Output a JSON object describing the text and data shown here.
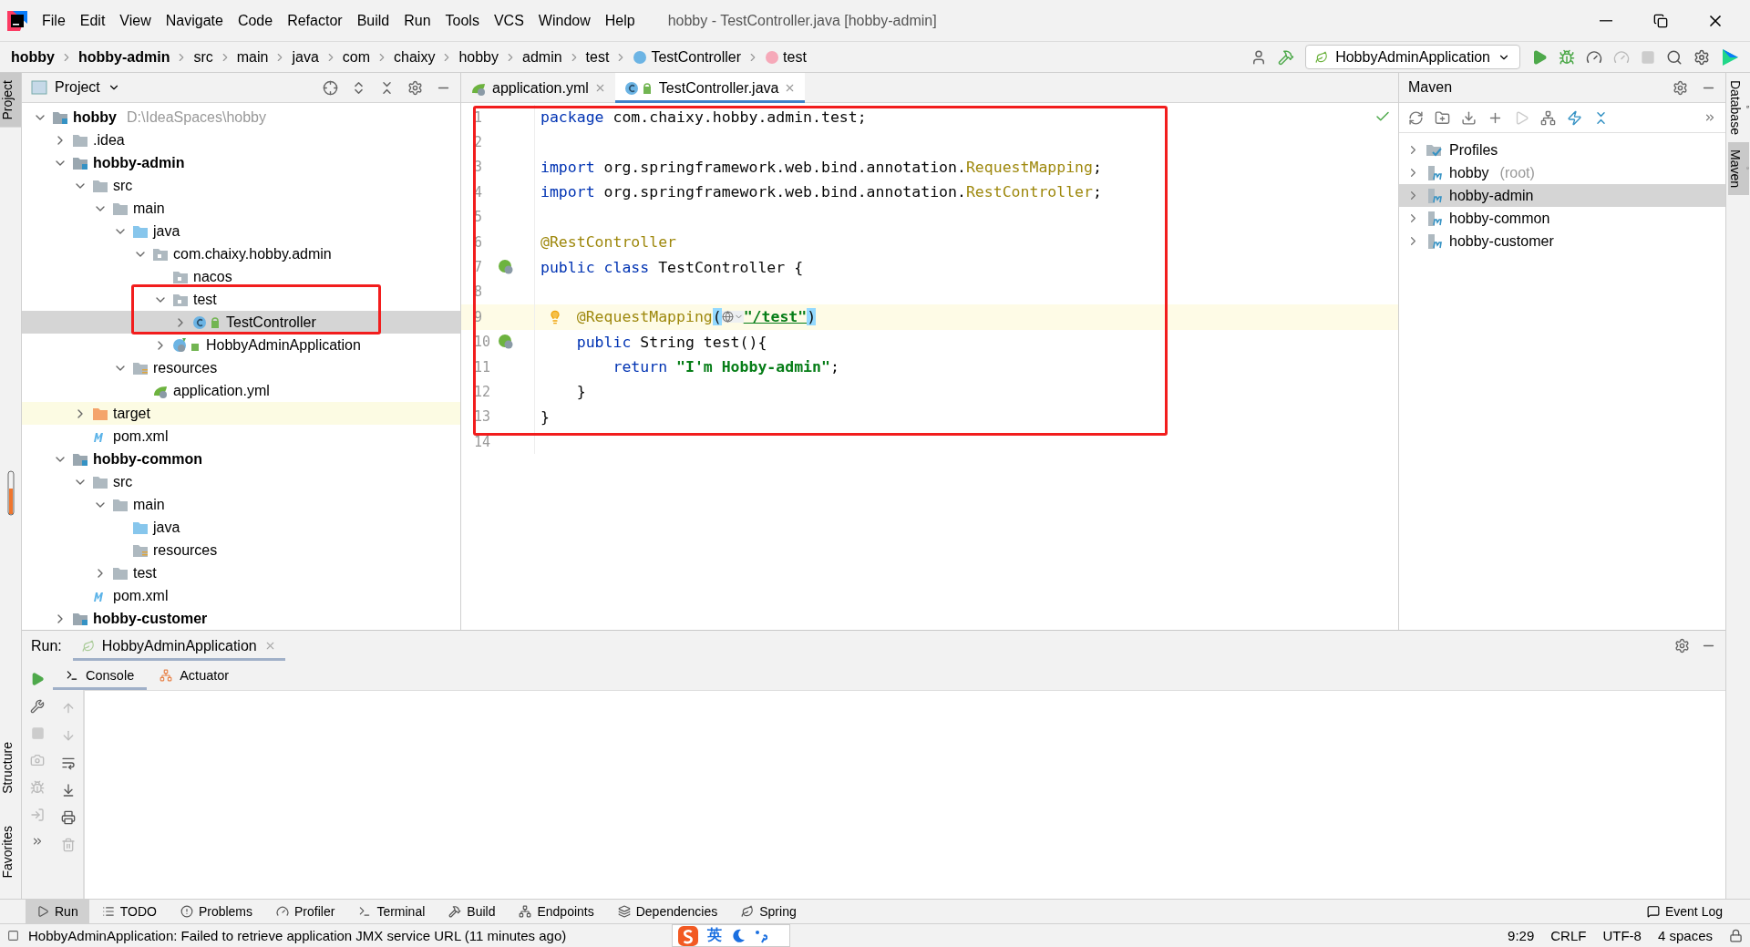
{
  "menu": [
    "File",
    "Edit",
    "View",
    "Navigate",
    "Code",
    "Refactor",
    "Build",
    "Run",
    "Tools",
    "VCS",
    "Window",
    "Help"
  ],
  "window_title": "hobby - TestController.java [hobby-admin]",
  "breadcrumbs": [
    {
      "label": "hobby",
      "kind": "module"
    },
    {
      "label": "hobby-admin",
      "kind": "module"
    },
    {
      "label": "src",
      "kind": "folder"
    },
    {
      "label": "main",
      "kind": "folder"
    },
    {
      "label": "java",
      "kind": "folder"
    },
    {
      "label": "com",
      "kind": "folder"
    },
    {
      "label": "chaixy",
      "kind": "folder"
    },
    {
      "label": "hobby",
      "kind": "folder"
    },
    {
      "label": "admin",
      "kind": "folder"
    },
    {
      "label": "test",
      "kind": "folder"
    },
    {
      "label": "TestController",
      "kind": "class"
    },
    {
      "label": "test",
      "kind": "method"
    }
  ],
  "run_config": "HobbyAdminApplication",
  "left_stripe": {
    "top": [
      {
        "label": "Project",
        "selected": true
      }
    ],
    "bottom": [
      {
        "label": "Structure",
        "selected": false
      },
      {
        "label": "Favorites",
        "selected": false
      }
    ]
  },
  "right_stripe": [
    {
      "label": "Database",
      "selected": false
    },
    {
      "label": "Maven",
      "selected": true
    }
  ],
  "project": {
    "title": "Project",
    "framed": true,
    "tree": [
      {
        "label": "hobby",
        "hint": "D:\\IdeaSpaces\\hobby",
        "kind": "module",
        "expanded": true,
        "selected": false,
        "children": [
          {
            "label": ".idea",
            "kind": "folder",
            "expanded": false,
            "selected": false
          },
          {
            "label": "hobby-admin",
            "kind": "module",
            "expanded": true,
            "selected": false,
            "children": [
              {
                "label": "src",
                "kind": "folder",
                "expanded": true,
                "selected": false,
                "children": [
                  {
                    "label": "main",
                    "kind": "folder",
                    "expanded": true,
                    "selected": false,
                    "children": [
                      {
                        "label": "java",
                        "kind": "source",
                        "expanded": true,
                        "selected": false,
                        "children": [
                          {
                            "label": "com.chaixy.hobby.admin",
                            "kind": "package",
                            "expanded": true,
                            "selected": false,
                            "children": [
                              {
                                "label": "nacos",
                                "kind": "package",
                                "selected": false
                              },
                              {
                                "label": "test",
                                "kind": "package",
                                "expanded": true,
                                "selected": false,
                                "children": [
                                  {
                                    "label": "TestController",
                                    "kind": "class",
                                    "expanded": false,
                                    "selected": true
                                  }
                                ]
                              },
                              {
                                "label": "HobbyAdminApplication",
                                "kind": "spring-class",
                                "expanded": false,
                                "selected": false
                              }
                            ]
                          }
                        ]
                      },
                      {
                        "label": "resources",
                        "kind": "resources",
                        "expanded": true,
                        "selected": false,
                        "children": [
                          {
                            "label": "application.yml",
                            "kind": "yml",
                            "selected": false
                          }
                        ]
                      }
                    ]
                  }
                ]
              },
              {
                "label": "target",
                "kind": "target",
                "expanded": false,
                "selected": false,
                "excluded": true
              },
              {
                "label": "pom.xml",
                "kind": "pom",
                "selected": false
              }
            ]
          },
          {
            "label": "hobby-common",
            "kind": "module",
            "expanded": true,
            "selected": false,
            "children": [
              {
                "label": "src",
                "kind": "folder",
                "expanded": true,
                "selected": false,
                "children": [
                  {
                    "label": "main",
                    "kind": "folder",
                    "expanded": true,
                    "selected": false,
                    "children": [
                      {
                        "label": "java",
                        "kind": "source",
                        "selected": false
                      },
                      {
                        "label": "resources",
                        "kind": "resources",
                        "selected": false
                      }
                    ]
                  },
                  {
                    "label": "test",
                    "kind": "folder",
                    "expanded": false,
                    "selected": false
                  }
                ]
              },
              {
                "label": "pom.xml",
                "kind": "pom",
                "selected": false
              }
            ]
          },
          {
            "label": "hobby-customer",
            "kind": "module",
            "expanded": false,
            "selected": false
          }
        ]
      }
    ]
  },
  "tabs": [
    {
      "label": "application.yml",
      "kind": "yml",
      "selected": false
    },
    {
      "label": "TestController.java",
      "kind": "class",
      "selected": true
    }
  ],
  "code": [
    {
      "number": "1",
      "tokens": [
        {
          "t": "package",
          "kind": "kw"
        },
        {
          "t": " com.chaixy.hobby.admin.test;",
          "kind": "plain"
        }
      ]
    },
    {
      "number": "2"
    },
    {
      "number": "3",
      "tokens": [
        {
          "t": "import",
          "kind": "kw"
        },
        {
          "t": " org.springframework.web.bind.annotation.",
          "kind": "plain"
        },
        {
          "t": "RequestMapping",
          "kind": "ann"
        },
        {
          "t": ";",
          "kind": "plain"
        }
      ]
    },
    {
      "number": "4",
      "tokens": [
        {
          "t": "import",
          "kind": "kw"
        },
        {
          "t": " org.springframework.web.bind.annotation.",
          "kind": "plain"
        },
        {
          "t": "RestController",
          "kind": "ann"
        },
        {
          "t": ";",
          "kind": "plain"
        }
      ]
    },
    {
      "number": "5"
    },
    {
      "number": "6",
      "tokens": [
        {
          "t": "@RestController",
          "kind": "ann"
        }
      ]
    },
    {
      "number": "7",
      "kind": "bean",
      "tokens": [
        {
          "t": "public class",
          "kind": "kw"
        },
        {
          "t": " TestController {",
          "kind": "plain"
        }
      ]
    },
    {
      "number": "8"
    },
    {
      "number": "9",
      "current": true,
      "intention": true,
      "tokens": [
        {
          "t": "    @RequestMapping",
          "kind": "ann"
        },
        {
          "t": "(",
          "kind": "brace"
        },
        {
          "kind": "inlay"
        },
        {
          "t": "\"/test\"",
          "kind": "link"
        },
        {
          "t": ")",
          "kind": "brace"
        }
      ]
    },
    {
      "number": "10",
      "kind": "bean",
      "tokens": [
        {
          "t": "    public",
          "kind": "kw"
        },
        {
          "t": " String test(){",
          "kind": "plain"
        }
      ]
    },
    {
      "number": "11",
      "tokens": [
        {
          "t": "        return",
          "kind": "kw"
        },
        {
          "t": " \"I'm Hobby-admin\"",
          "kind": "str"
        },
        {
          "t": ";",
          "kind": "plain"
        }
      ]
    },
    {
      "number": "12",
      "tokens": [
        {
          "t": "    }",
          "kind": "plain"
        }
      ]
    },
    {
      "number": "13",
      "tokens": [
        {
          "t": "}",
          "kind": "plain"
        }
      ]
    },
    {
      "number": "14"
    }
  ],
  "editor": {
    "framed": true
  },
  "maven": {
    "title": "Maven",
    "items": [
      {
        "label": "Profiles",
        "kind": "profiles",
        "selected": false
      },
      {
        "label": "hobby",
        "suffix": "(root)",
        "kind": "module",
        "selected": false
      },
      {
        "label": "hobby-admin",
        "kind": "module",
        "selected": true
      },
      {
        "label": "hobby-common",
        "kind": "module",
        "selected": false
      },
      {
        "label": "hobby-customer",
        "kind": "module",
        "selected": false
      }
    ]
  },
  "run": {
    "label": "Run:",
    "tab": "HobbyAdminApplication",
    "subtabs": [
      {
        "label": "Console",
        "selected": true
      },
      {
        "label": "Actuator",
        "selected": false
      }
    ]
  },
  "bottom_tabs": [
    {
      "label": "Run",
      "selected": true
    },
    {
      "label": "TODO",
      "selected": false
    },
    {
      "label": "Problems",
      "selected": false
    },
    {
      "label": "Profiler",
      "selected": false
    },
    {
      "label": "Terminal",
      "selected": false
    },
    {
      "label": "Build",
      "selected": false
    },
    {
      "label": "Endpoints",
      "selected": false
    },
    {
      "label": "Dependencies",
      "selected": false
    },
    {
      "label": "Spring",
      "selected": false
    }
  ],
  "event_log": "Event Log",
  "status": {
    "message": "HobbyAdminApplication: Failed to retrieve application JMX service URL (11 minutes ago)",
    "items": [
      "9:29",
      "CRLF",
      "UTF-8",
      "4 spaces"
    ]
  },
  "ime": {
    "mode": "英"
  }
}
